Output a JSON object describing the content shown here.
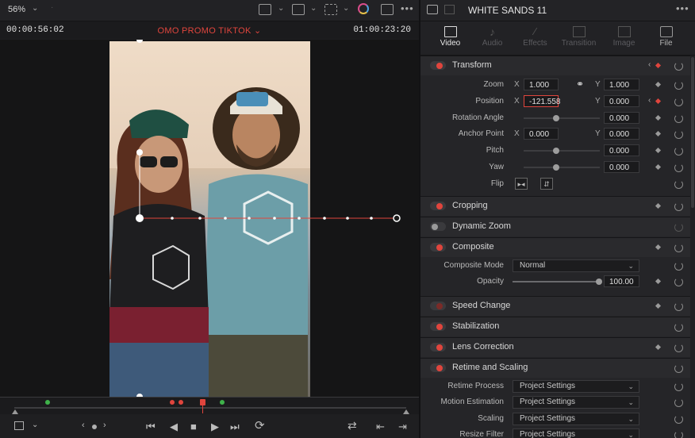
{
  "viewer": {
    "zoom": "56%",
    "timecode_left": "00:00:56:02",
    "timeline_name": "OMO PROMO TIKTOK",
    "timecode_right": "01:00:23:20"
  },
  "inspector": {
    "clip_title": "WHITE SANDS 11",
    "tabs": [
      {
        "label": "Video",
        "active": true
      },
      {
        "label": "Audio",
        "active": false
      },
      {
        "label": "Effects",
        "active": false
      },
      {
        "label": "Transition",
        "active": false
      },
      {
        "label": "Image",
        "active": false
      },
      {
        "label": "File",
        "active": false
      }
    ],
    "transform": {
      "title": "Transform",
      "zoom_label": "Zoom",
      "zoom_x": "1.000",
      "zoom_y": "1.000",
      "position_label": "Position",
      "position_x": "-121.558",
      "position_y": "0.000",
      "rotation_label": "Rotation Angle",
      "rotation": "0.000",
      "anchor_label": "Anchor Point",
      "anchor_x": "0.000",
      "anchor_y": "0.000",
      "pitch_label": "Pitch",
      "pitch": "0.000",
      "yaw_label": "Yaw",
      "yaw": "0.000",
      "flip_label": "Flip",
      "x_axis": "X",
      "y_axis": "Y"
    },
    "cropping": "Cropping",
    "dynamic_zoom": "Dynamic Zoom",
    "composite": {
      "title": "Composite",
      "mode_label": "Composite Mode",
      "mode_value": "Normal",
      "opacity_label": "Opacity",
      "opacity_value": "100.00"
    },
    "speed_change": "Speed Change",
    "stabilization": "Stabilization",
    "lens_correction": "Lens Correction",
    "retime": {
      "title": "Retime and Scaling",
      "retime_process_label": "Retime Process",
      "retime_process_value": "Project Settings",
      "motion_label": "Motion Estimation",
      "motion_value": "Project Settings",
      "scaling_label": "Scaling",
      "scaling_value": "Project Settings",
      "resize_label": "Resize Filter",
      "resize_value": "Project Settings"
    }
  },
  "colors": {
    "accent": "#e0453d",
    "keyframe_red": "#e0453d",
    "marker_green": "#3fb24a"
  }
}
